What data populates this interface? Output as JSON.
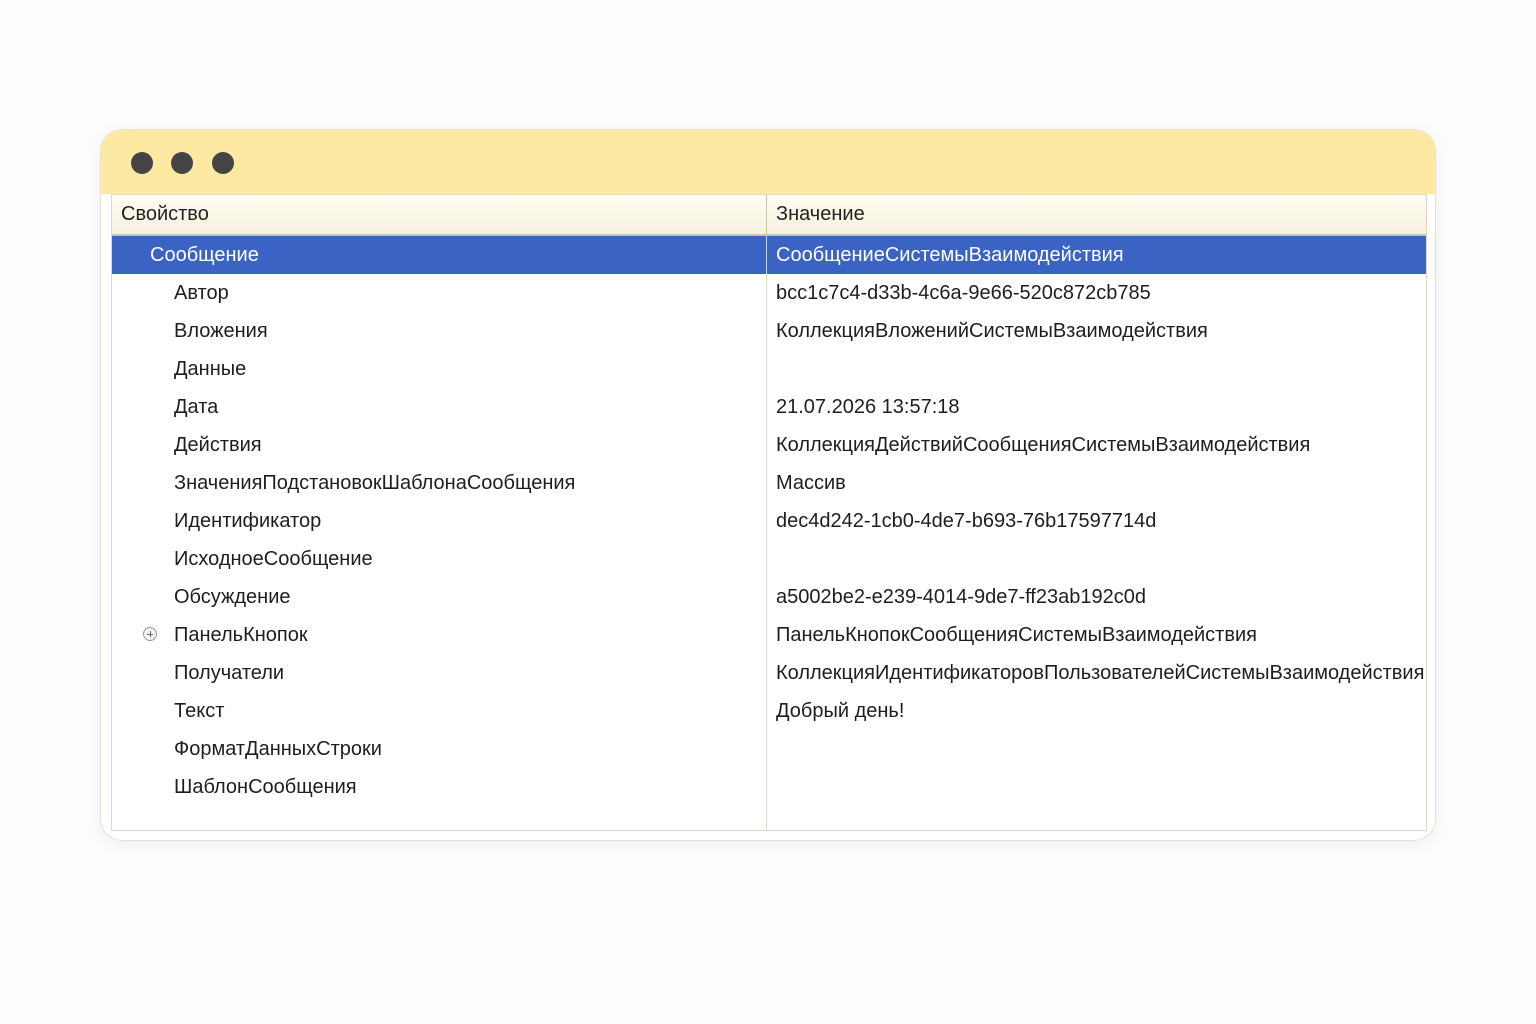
{
  "colors": {
    "titlebar": "#fde9a2",
    "selection": "#3a63c4",
    "window_dots": "#444444"
  },
  "window": {
    "controls": [
      "close-dot",
      "minimize-dot",
      "maximize-dot"
    ]
  },
  "table": {
    "columns": {
      "property": "Свойство",
      "value": "Значение"
    },
    "rows": [
      {
        "property": "Сообщение",
        "value": "СообщениеСистемыВзаимодействия",
        "selected": true,
        "level": 0
      },
      {
        "property": "Автор",
        "value": "bcc1c7c4-d33b-4c6a-9e66-520c872cb785",
        "level": 1
      },
      {
        "property": "Вложения",
        "value": "КоллекцияВложенийСистемыВзаимодействия",
        "level": 1
      },
      {
        "property": "Данные",
        "value": "",
        "level": 1
      },
      {
        "property": "Дата",
        "value": "21.07.2026 13:57:18",
        "level": 1
      },
      {
        "property": "Действия",
        "value": "КоллекцияДействийСообщенияСистемыВзаимодействия",
        "level": 1
      },
      {
        "property": "ЗначенияПодстановокШаблонаСообщения",
        "value": "Массив",
        "level": 1
      },
      {
        "property": "Идентификатор",
        "value": "dec4d242-1cb0-4de7-b693-76b17597714d",
        "level": 1
      },
      {
        "property": "ИсходноеСообщение",
        "value": "",
        "level": 1
      },
      {
        "property": "Обсуждение",
        "value": "a5002be2-e239-4014-9de7-ff23ab192c0d",
        "level": 1
      },
      {
        "property": "ПанельКнопок",
        "value": "ПанельКнопокСообщенияСистемыВзаимодействия",
        "level": 1,
        "expandable": true,
        "expander_icon": "plus-circle-icon"
      },
      {
        "property": "Получатели",
        "value": "КоллекцияИдентификаторовПользователейСистемыВзаимодействия",
        "level": 1
      },
      {
        "property": "Текст",
        "value": "Добрый день!",
        "level": 1
      },
      {
        "property": "ФорматДанныхСтроки",
        "value": "",
        "level": 1
      },
      {
        "property": "ШаблонСообщения",
        "value": "",
        "level": 1
      }
    ]
  }
}
